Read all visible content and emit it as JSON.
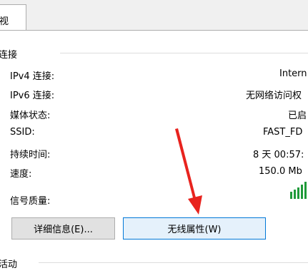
{
  "tab": {
    "label": "视"
  },
  "connection_group": {
    "title": "连接"
  },
  "rows": [
    {
      "label": "IPv4 连接:",
      "value": "Intern"
    },
    {
      "label": "IPv6 连接:",
      "value": "无网络访问权"
    },
    {
      "label": "媒体状态:",
      "value": "已启"
    },
    {
      "label": "SSID:",
      "value": "FAST_FD"
    },
    {
      "label": "持续时间:",
      "value": "8 天 00:57:"
    },
    {
      "label": "速度:",
      "value": "150.0 Mb"
    }
  ],
  "signal": {
    "label": "信号质量:",
    "bars": 5,
    "color": "#1f9a3a"
  },
  "buttons": {
    "details": "详细信息(E)...",
    "wireless_properties": "无线属性(W)"
  },
  "activity_group": {
    "title": "活动"
  },
  "annotation_arrow": {
    "color": "#e8231e"
  }
}
